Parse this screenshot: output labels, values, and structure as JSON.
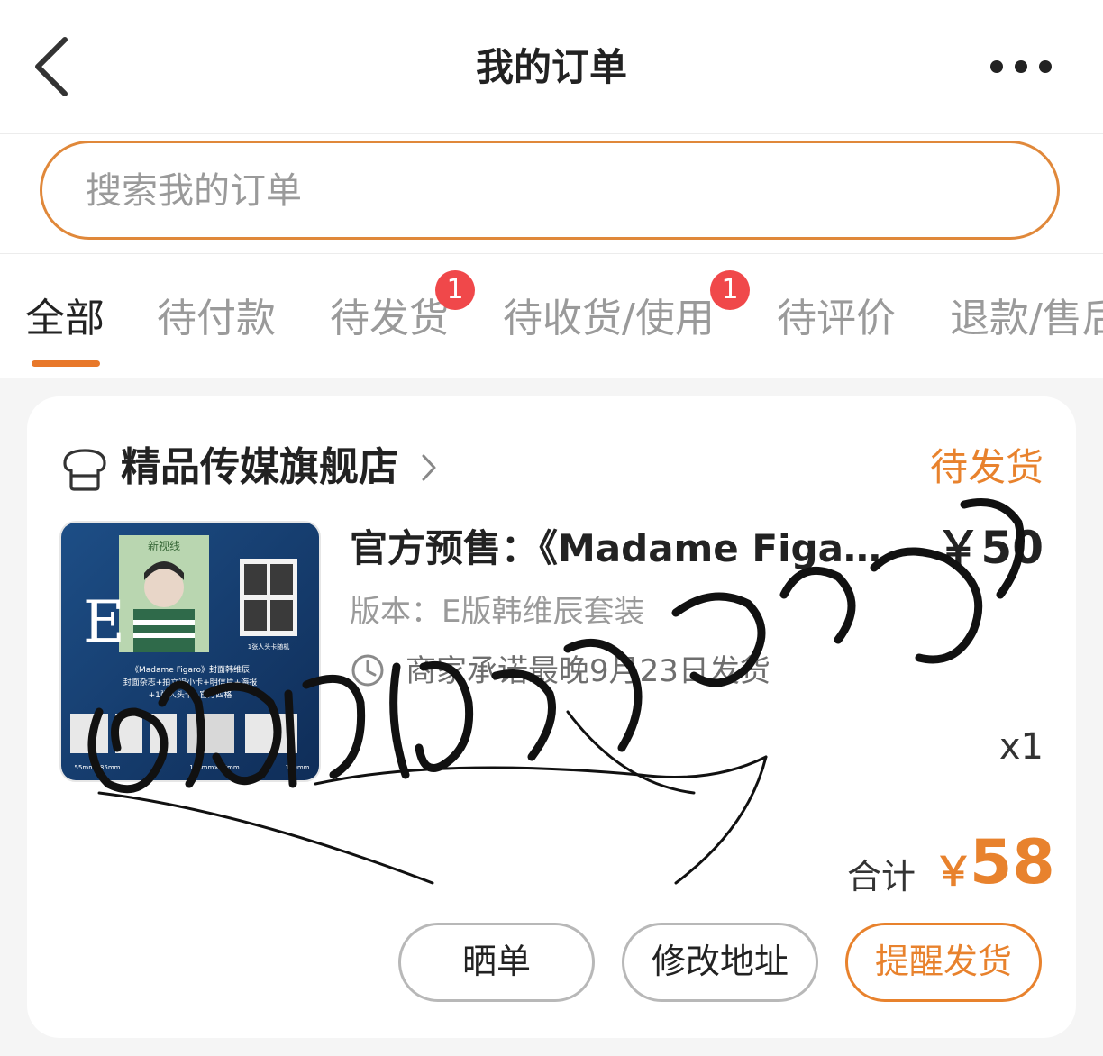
{
  "header": {
    "title": "我的订单",
    "back_icon": "chevron-left-icon",
    "more_icon": "more-horizontal-icon"
  },
  "search": {
    "placeholder": "搜索我的订单",
    "value": "",
    "border_color": "#e0883a"
  },
  "tabs": [
    {
      "label": "全部",
      "active": true
    },
    {
      "label": "待付款"
    },
    {
      "label": "待发货",
      "badge": "1"
    },
    {
      "label": "待收货/使用",
      "badge": "1"
    },
    {
      "label": "待评价"
    },
    {
      "label": "退款/售后"
    }
  ],
  "order": {
    "store_name": "精品传媒旗舰店",
    "store_icon": "store-icon",
    "status": "待发货",
    "product": {
      "title": "官方预售：《Madame Figaro》时尚杂志",
      "unit_price": "￥50",
      "variant": "版本：E版韩维辰套装",
      "shipping_note": "商家承诺最晚9月23日发货",
      "quantity": "x1",
      "thumbnail": {
        "masthead": "新视线",
        "letter": "E",
        "caption_line1": "《Madame Figaro》封面韩维辰",
        "caption_line2": "封面杂志+拍立得小卡+明信片+海报",
        "caption_line3": "+1张人头卡+官方四格",
        "badge": "1张人头卡随机",
        "spec1": "55mm×85mm",
        "spec2": "108mm×86mm",
        "spec3": "100mm"
      }
    },
    "total_label": "合计",
    "total_currency": "￥",
    "total_value": "58",
    "buttons": {
      "share": "晒单",
      "edit_address": "修改地址",
      "remind_ship": "提醒发货"
    }
  },
  "colors": {
    "accent": "#e8822d",
    "badge": "#f0484a",
    "muted_text": "#9a9a9a",
    "card_bg": "#ffffff",
    "page_bg": "#f5f5f5"
  }
}
